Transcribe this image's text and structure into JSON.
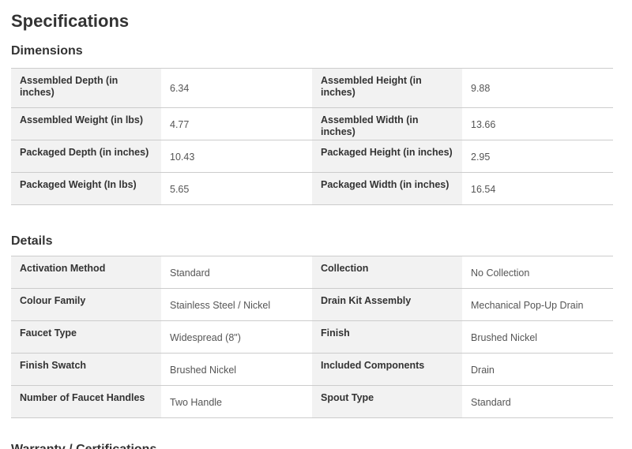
{
  "page": {
    "title": "Specifications"
  },
  "dimensions": {
    "title": "Dimensions",
    "rows": [
      [
        {
          "label": "Assembled Depth (in inches)",
          "value": "6.34"
        },
        {
          "label": "Assembled Height (in inches)",
          "value": "9.88"
        }
      ],
      [
        {
          "label": "Assembled Weight (in lbs)",
          "value": "4.77"
        },
        {
          "label": "Assembled Width (in inches)",
          "value": "13.66"
        }
      ],
      [
        {
          "label": "Packaged Depth (in inches)",
          "value": "10.43"
        },
        {
          "label": "Packaged Height (in inches)",
          "value": "2.95"
        }
      ],
      [
        {
          "label": "Packaged Weight (In lbs)",
          "value": "5.65"
        },
        {
          "label": "Packaged Width (in inches)",
          "value": "16.54"
        }
      ]
    ]
  },
  "details": {
    "title": "Details",
    "rows": [
      [
        {
          "label": "Activation Method",
          "value": "Standard"
        },
        {
          "label": "Collection",
          "value": "No Collection"
        }
      ],
      [
        {
          "label": "Colour Family",
          "value": "Stainless Steel / Nickel"
        },
        {
          "label": "Drain Kit Assembly",
          "value": "Mechanical Pop-Up Drain"
        }
      ],
      [
        {
          "label": "Faucet Type",
          "value": "Widespread (8\")"
        },
        {
          "label": "Finish",
          "value": "Brushed Nickel"
        }
      ],
      [
        {
          "label": "Finish Swatch",
          "value": "Brushed Nickel"
        },
        {
          "label": "Included Components",
          "value": "Drain"
        }
      ],
      [
        {
          "label": "Number of Faucet Handles",
          "value": "Two Handle"
        },
        {
          "label": "Spout Type",
          "value": "Standard"
        }
      ]
    ]
  },
  "next_section": {
    "title": "Warranty / Certifications"
  }
}
